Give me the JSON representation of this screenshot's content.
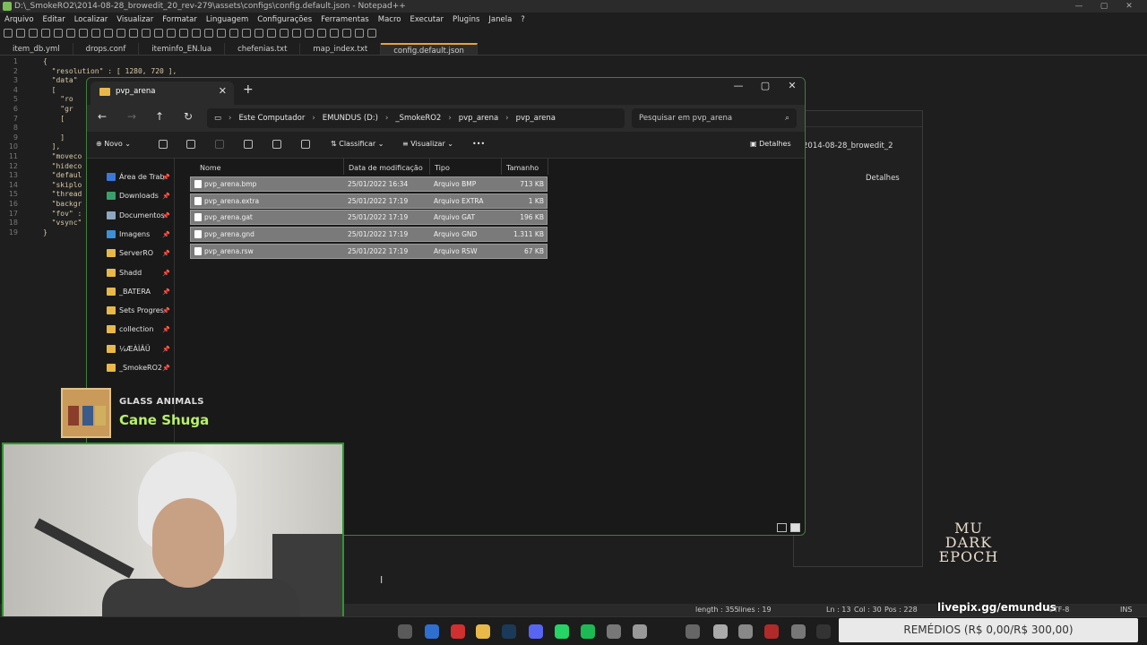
{
  "notepad": {
    "title": "D:\\_SmokeRO2\\2014-08-28_browedit_20_rev-279\\assets\\configs\\config.default.json - Notepad++",
    "menu": [
      "Arquivo",
      "Editar",
      "Localizar",
      "Visualizar",
      "Formatar",
      "Linguagem",
      "Configurações",
      "Ferramentas",
      "Macro",
      "Executar",
      "Plugins",
      "Janela",
      "?"
    ],
    "tabs": [
      "item_db.yml",
      "drops.conf",
      "iteminfo_EN.lua",
      "chefenias.txt",
      "map_index.txt",
      "config.default.json"
    ],
    "line_numbers": [
      "1",
      "2",
      "3",
      "4",
      "5",
      "6",
      "7",
      "8",
      "9",
      "10",
      "11",
      "12",
      "13",
      "14",
      "15",
      "16",
      "17",
      "18",
      "19"
    ],
    "code_lines": [
      "{",
      "  \"resolution\" : [ 1280, 720 ],",
      "  \"data\"",
      "  [",
      "    \"ro",
      "    \"gr",
      "    [",
      "",
      "    ]",
      "  ],",
      "  \"moveco",
      "  \"hideco",
      "  \"defaul",
      "  \"skiplo",
      "  \"thread",
      "  \"backgr",
      "  \"fov\" :",
      "  \"vsync\"",
      "}"
    ],
    "status": {
      "length": "length : 355",
      "lines": "lines : 19",
      "ln": "Ln : 13",
      "col": "Col : 30",
      "pos": "Pos : 228",
      "encoding": "UTF-8",
      "mode": "INS"
    }
  },
  "bg_explorer": {
    "address": "2014-08-28_browedit_2",
    "details": "Detalhes"
  },
  "explorer": {
    "tab_title": "pvp_arena",
    "breadcrumbs": [
      "Este Computador",
      "EMUNDUS (D:)",
      "_SmokeRO2",
      "pvp_arena",
      "pvp_arena"
    ],
    "search_placeholder": "Pesquisar em pvp_arena",
    "commands": {
      "new": "Novo",
      "sort": "Classificar",
      "view": "Visualizar",
      "details": "Detalhes"
    },
    "sidebar": [
      {
        "label": "Área de Trab.",
        "color": "#3a78d8"
      },
      {
        "label": "Downloads",
        "color": "#3aa06a"
      },
      {
        "label": "Documentos",
        "color": "#8fa6c0"
      },
      {
        "label": "Imagens",
        "color": "#3d8fd8"
      },
      {
        "label": "ServerRO",
        "color": "#e8b84a"
      },
      {
        "label": "Shadd",
        "color": "#e8b84a"
      },
      {
        "label": "_BATERA",
        "color": "#e8b84a"
      },
      {
        "label": "Sets Progress",
        "color": "#e8b84a"
      },
      {
        "label": "collection",
        "color": "#e8b84a"
      },
      {
        "label": "¼ÆÀÌÂÜ",
        "color": "#e8b84a"
      },
      {
        "label": "_SmokeRO2",
        "color": "#e8b84a"
      }
    ],
    "columns": [
      "Nome",
      "Data de modificação",
      "Tipo",
      "Tamanho"
    ],
    "files": [
      {
        "name": "pvp_arena.bmp",
        "date": "25/01/2022 16:34",
        "type": "Arquivo BMP",
        "size": "713 KB"
      },
      {
        "name": "pvp_arena.extra",
        "date": "25/01/2022 17:19",
        "type": "Arquivo EXTRA",
        "size": "1 KB"
      },
      {
        "name": "pvp_arena.gat",
        "date": "25/01/2022 17:19",
        "type": "Arquivo GAT",
        "size": "196 KB"
      },
      {
        "name": "pvp_arena.gnd",
        "date": "25/01/2022 17:19",
        "type": "Arquivo GND",
        "size": "1.311 KB"
      },
      {
        "name": "pvp_arena.rsw",
        "date": "25/01/2022 17:19",
        "type": "Arquivo RSW",
        "size": "67 KB"
      }
    ]
  },
  "overlay": {
    "artist": "GLASS ANIMALS",
    "song": "Cane Shuga",
    "livepix": "livepix.gg/emundus",
    "promo": "REMÉDIOS (R$ 0,00/R$ 300,00)",
    "logo_line1": "MU",
    "logo_line2": "DARK EPOCH"
  }
}
